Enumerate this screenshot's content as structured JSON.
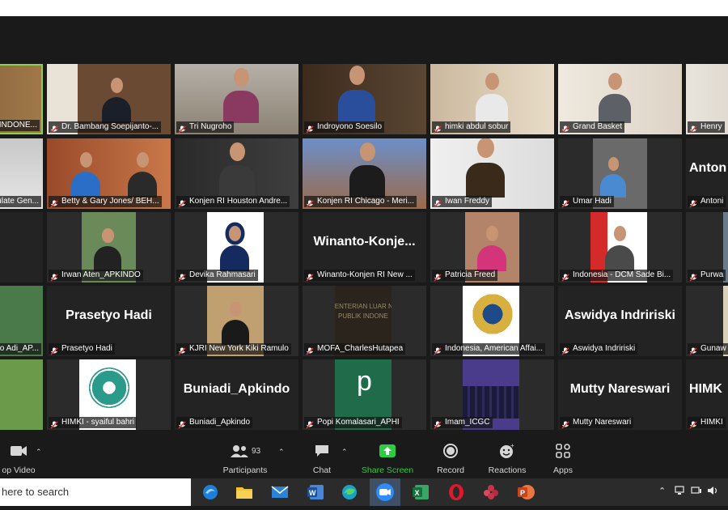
{
  "tiles": [
    {
      "name": "INDONE...",
      "name_only": false
    },
    {
      "name": "Dr. Bambang Soepijanto-...",
      "name_only": false
    },
    {
      "name": "Tri Nugroho",
      "name_only": false
    },
    {
      "name": "Indroyono Soesilo",
      "name_only": false
    },
    {
      "name": "himki abdul sobur",
      "name_only": false
    },
    {
      "name": "Grand Basket",
      "name_only": false
    },
    {
      "name": "Henry",
      "name_only": false
    },
    {
      "name": "ulate Gen...",
      "name_only": false
    },
    {
      "name": "Betty & Gary Jones/ BEH...",
      "name_only": false
    },
    {
      "name": "Konjen RI Houston Andre...",
      "name_only": false
    },
    {
      "name": "Konjen RI Chicago - Meri...",
      "name_only": false
    },
    {
      "name": "Iwan Freddy",
      "name_only": false
    },
    {
      "name": "Umar Hadi",
      "name_only": false
    },
    {
      "name": "Antoni",
      "display": "Anton",
      "name_only": true
    },
    {
      "name": "",
      "name_only": false
    },
    {
      "name": "Irwan Aten_APKINDO",
      "name_only": false
    },
    {
      "name": "Devika Rahmasari",
      "name_only": false
    },
    {
      "name": "Winanto-Konjen RI New ...",
      "display": "Winanto-Konje...",
      "name_only": true
    },
    {
      "name": "Patricia Freed",
      "name_only": false
    },
    {
      "name": "Indonesia - DCM Sade Bi...",
      "name_only": false
    },
    {
      "name": "Purwa",
      "name_only": false
    },
    {
      "name": "o Adi_AP...",
      "name_only": false
    },
    {
      "name": "Prasetyo Hadi",
      "display": "Prasetyo Hadi",
      "name_only": true
    },
    {
      "name": "KJRI New York Kiki Ramulo",
      "name_only": false
    },
    {
      "name": "MOFA_CharlesHutapea",
      "name_only": false
    },
    {
      "name": "Indonesia, American Affai...",
      "name_only": false
    },
    {
      "name": "Aswidya Indririski",
      "display": "Aswidya Indririski",
      "name_only": true
    },
    {
      "name": "Gunaw",
      "name_only": false
    },
    {
      "name": "",
      "name_only": false
    },
    {
      "name": "HIMKI - syaiful bahri",
      "name_only": false
    },
    {
      "name": "Buniadi_Apkindo",
      "display": "Buniadi_Apkindo",
      "name_only": true
    },
    {
      "name": "Popi Komalasari_APHI",
      "name_only": false
    },
    {
      "name": "Imam_ICGC",
      "name_only": false
    },
    {
      "name": "Mutty Nareswari",
      "display": "Mutty Nareswari",
      "name_only": true
    },
    {
      "name": "HIMKI",
      "display": "HIMK",
      "name_only": true
    }
  ],
  "popi_avatar_letter": "p",
  "mofa_sign": {
    "line1": "ENTERIAN LUAR N",
    "line2": "PUBLIK INDONE"
  },
  "toolbar": {
    "video_label": "op Video",
    "participants_label": "Participants",
    "participants_count": "93",
    "chat_label": "Chat",
    "share_label": "Share Screen",
    "record_label": "Record",
    "reactions_label": "Reactions",
    "apps_label": "Apps"
  },
  "taskbar": {
    "search_placeholder": "here to search",
    "apps": [
      "edge-legacy",
      "file-explorer",
      "mail",
      "word",
      "edge",
      "zoom",
      "excel",
      "opera",
      "flower-app",
      "powerpoint"
    ]
  },
  "colors": {
    "share_green": "#2ecc40",
    "active_border": "#8bd14a",
    "mute_red": "#e5383b"
  }
}
